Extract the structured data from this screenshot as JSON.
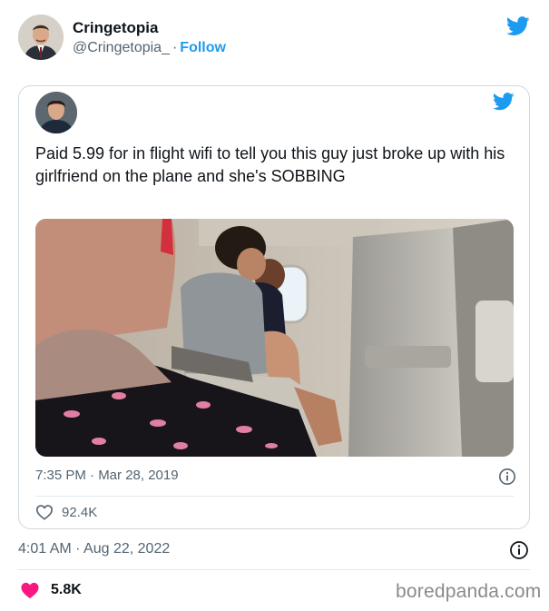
{
  "outer_tweet": {
    "display_name": "Cringetopia",
    "handle": "@Cringetopia_",
    "separator": "·",
    "follow_label": "Follow",
    "timestamp": "4:01 AM · Aug 22, 2022",
    "likes": "5.8K"
  },
  "quoted_tweet": {
    "text": "Paid 5.99 for in flight wifi to tell you this guy just broke up with his girlfriend on the plane and she's SOBBING",
    "timestamp": "7:35 PM · Mar 28, 2019",
    "likes": "92.4K"
  },
  "watermark": "boredpanda.com",
  "colors": {
    "twitter_blue": "#1d9bf0",
    "like_heart": "#f91880",
    "secondary_text": "#536471",
    "border": "#cfd9de"
  },
  "icons": {
    "brand": "twitter-bird-icon",
    "info": "info-icon",
    "like_outline": "heart-outline-icon",
    "like_filled": "heart-filled-icon"
  }
}
